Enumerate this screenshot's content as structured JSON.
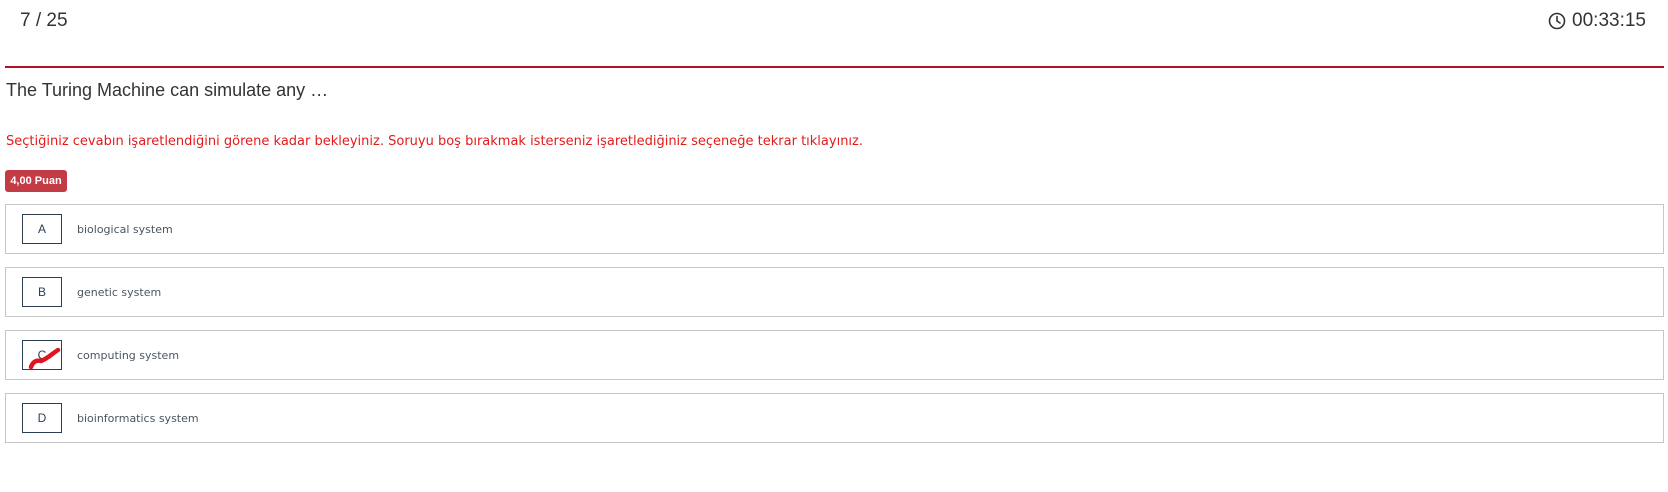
{
  "header": {
    "counter": "7 / 25",
    "timer": "00:33:15"
  },
  "question": {
    "text": "The Turing Machine can simulate any …",
    "warning": "Seçtiğiniz cevabın işaretlendiğini görene kadar bekleyiniz. Soruyu boş bırakmak isterseniz işaretlediğiniz seçeneğe tekrar tıklayınız.",
    "points": "4,00 Puan"
  },
  "options": [
    {
      "letter": "A",
      "text": "biological system",
      "selected": false
    },
    {
      "letter": "B",
      "text": "genetic system",
      "selected": false
    },
    {
      "letter": "C",
      "text": "computing system",
      "selected": true
    },
    {
      "letter": "D",
      "text": "bioinformatics system",
      "selected": false
    }
  ],
  "colors": {
    "accent": "#b01226",
    "warning": "#e31b1b",
    "badge": "#c33b45",
    "mark": "#e0141e"
  },
  "icons": {
    "timer": "clock-icon",
    "selected_mark": "checkmark-scribble-icon"
  }
}
